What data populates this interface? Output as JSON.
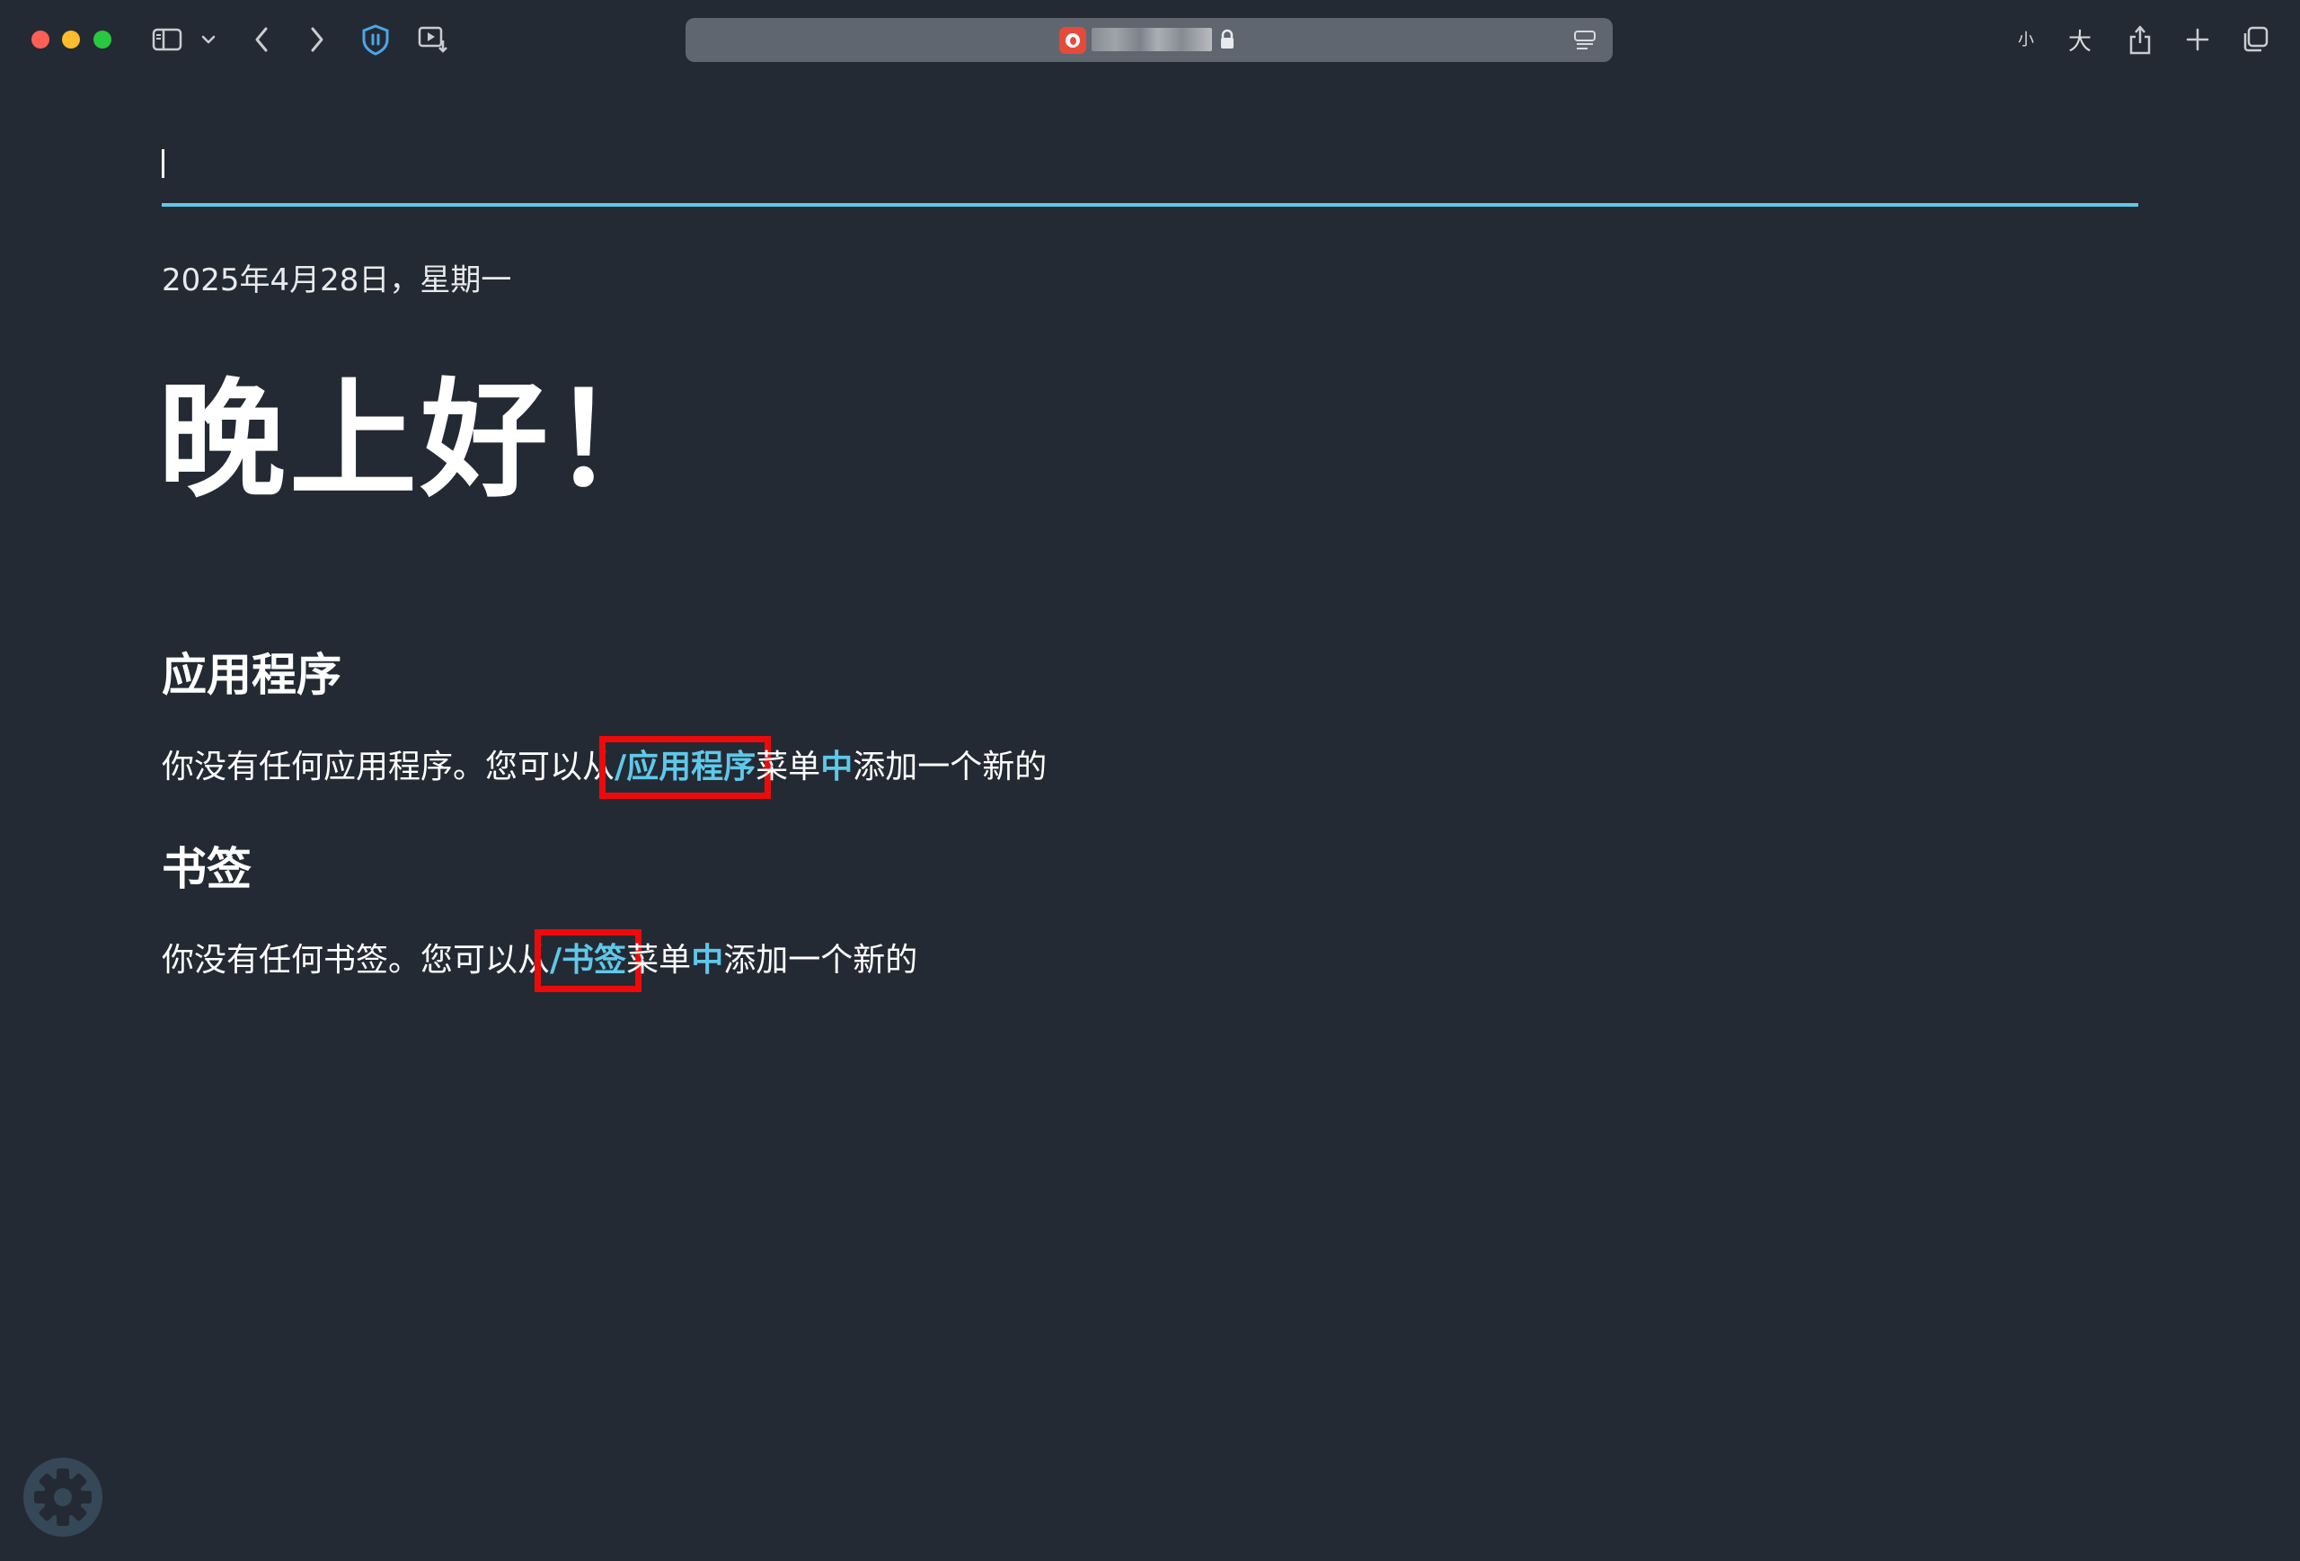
{
  "browser": {
    "url_text": "",
    "text_size_small_label": "小",
    "text_size_large_label": "大"
  },
  "search": {
    "value": "",
    "placeholder": ""
  },
  "main": {
    "date": "2025年4月28日，星期一",
    "greeting": "晚上好！",
    "apps": {
      "title": "应用程序",
      "text_before": "你没有任何应用程序。您可以从",
      "menu_link": "/应用程序",
      "text_menu": "菜单",
      "text_in": "中",
      "text_after": "添加一个新的"
    },
    "bookmarks": {
      "title": "书签",
      "text_before": "你没有任何书签。您可以从",
      "menu_link": "/书签",
      "text_menu": "菜单",
      "text_in": "中",
      "text_after": "添加一个新的"
    }
  },
  "colors": {
    "background": "#242a33",
    "accent": "#5fc8ea",
    "annotation": "#ee0a0a"
  },
  "icons": {
    "sidebar": "sidebar-icon",
    "chevron_down": "chevron-down-icon",
    "back": "back-icon",
    "forward": "forward-icon",
    "shield": "shield-icon",
    "media": "media-download-icon",
    "lock": "lock-icon",
    "reader": "reader-icon",
    "share": "share-icon",
    "new_tab": "plus-icon",
    "tabs": "tabs-overview-icon",
    "settings": "gear-icon"
  }
}
